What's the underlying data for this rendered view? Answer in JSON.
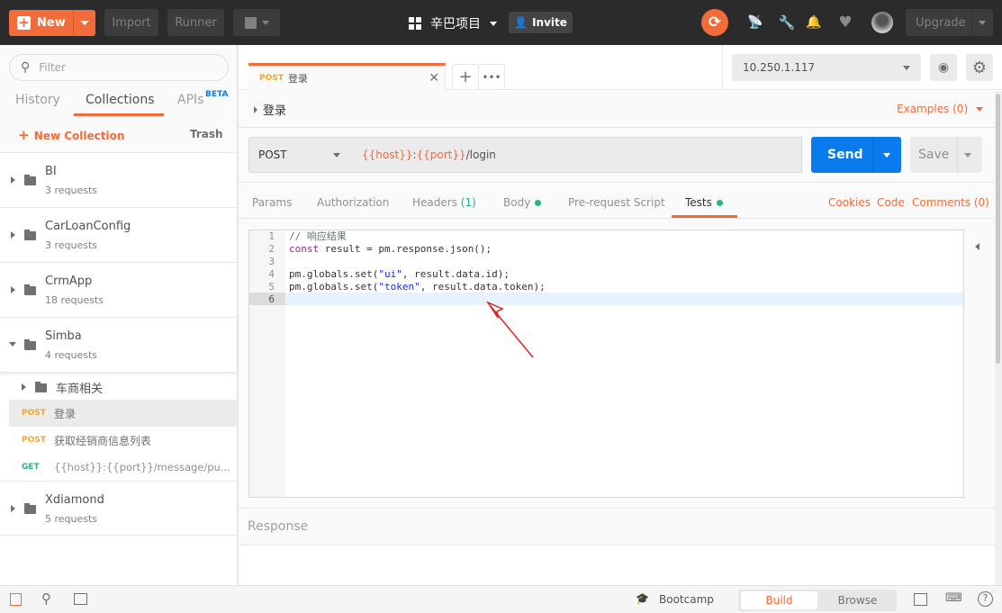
{
  "topbar": {
    "new": "New",
    "import": "Import",
    "runner": "Runner",
    "workspace": "辛巴项目",
    "invite": "Invite",
    "upgrade": "Upgrade"
  },
  "sidebar": {
    "filter_placeholder": "Filter",
    "tabs": [
      "History",
      "Collections",
      "APIs"
    ],
    "beta": "BETA",
    "new_collection": "New Collection",
    "trash": "Trash",
    "collections": [
      {
        "name": "BI",
        "count": "3 requests"
      },
      {
        "name": "CarLoanConfig",
        "count": "3 requests"
      },
      {
        "name": "CrmApp",
        "count": "18 requests"
      },
      {
        "name": "Simba",
        "count": "4 requests"
      },
      {
        "name": "Xdiamond",
        "count": "5 requests"
      }
    ],
    "simba_children": {
      "folder": "车商相关",
      "requests": [
        {
          "method": "POST",
          "name": "登录"
        },
        {
          "method": "POST",
          "name": "获取经销商信息列表"
        },
        {
          "method": "GET",
          "name": "{{host}}:{{port}}/message/pu..."
        }
      ]
    }
  },
  "tab": {
    "method": "POST",
    "name": "登录"
  },
  "environment": {
    "selected": "10.250.1.117"
  },
  "request": {
    "title": "登录",
    "examples": "Examples (0)",
    "method": "POST",
    "url_host": "{{host}}",
    "url_sep": ":",
    "url_port": "{{port}}",
    "url_path": "/login",
    "send": "Send",
    "save": "Save"
  },
  "subtabs": {
    "params": "Params",
    "authorization": "Authorization",
    "headers": "Headers",
    "headers_count": "(1)",
    "body": "Body",
    "prerequest": "Pre-request Script",
    "tests": "Tests",
    "cookies": "Cookies",
    "code": "Code",
    "comments": "Comments (0)"
  },
  "editor": {
    "lines": [
      "// 响应结果",
      "const result = pm.response.json();",
      "",
      "pm.globals.set(\"ui\", result.data.id);",
      "pm.globals.set(\"token\", result.data.token);",
      ""
    ]
  },
  "response": {
    "label": "Response"
  },
  "bottombar": {
    "bootcamp": "Bootcamp",
    "build": "Build",
    "browse": "Browse"
  },
  "colors": {
    "accent": "#f26b3a",
    "send": "#097bed",
    "topbar": "#2b2b2b",
    "annotation_arrow": "#e02020"
  }
}
